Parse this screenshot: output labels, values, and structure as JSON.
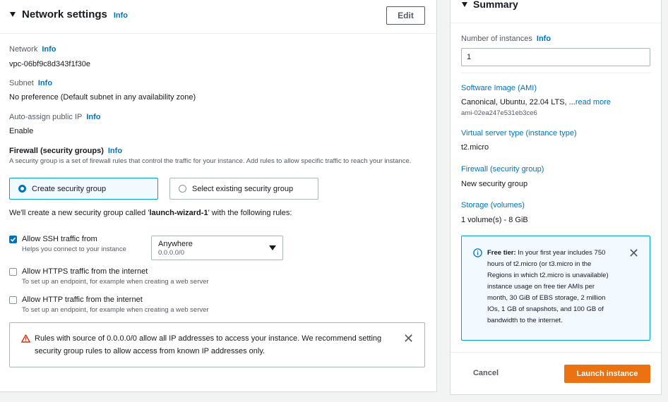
{
  "network_settings": {
    "title": "Network settings",
    "info": "Info",
    "edit_label": "Edit",
    "network_label": "Network",
    "network_value": "vpc-06bf9c8d343f1f30e",
    "subnet_label": "Subnet",
    "subnet_value": "No preference (Default subnet in any availability zone)",
    "public_ip_label": "Auto-assign public IP",
    "public_ip_value": "Enable",
    "firewall_label": "Firewall (security groups)",
    "firewall_desc": "A security group is a set of firewall rules that control the traffic for your instance. Add rules to allow specific traffic to reach your instance.",
    "create_sg_label": "Create security group",
    "select_sg_label": "Select existing security group",
    "sg_note_prefix": "We'll create a new security group called '",
    "sg_name": "launch-wizard-1",
    "sg_note_suffix": "' with the following rules:",
    "rules": [
      {
        "label": "Allow SSH traffic from",
        "desc": "Helps you connect to your instance",
        "checked": true
      },
      {
        "label": "Allow HTTPS traffic from the internet",
        "desc": "To set up an endpoint, for example when creating a web server",
        "checked": false
      },
      {
        "label": "Allow HTTP traffic from the internet",
        "desc": "To set up an endpoint, for example when creating a web server",
        "checked": false
      }
    ],
    "ssh_source": {
      "value": "Anywhere",
      "sub": "0.0.0.0/0"
    },
    "warning_text": "Rules with source of 0.0.0.0/0 allow all IP addresses to access your instance. We recommend setting security group rules to allow access from known IP addresses only."
  },
  "summary": {
    "title": "Summary",
    "instances_label": "Number of instances",
    "info": "Info",
    "instances_value": "1",
    "ami_label": "Software Image (AMI)",
    "ami_value": "Canonical, Ubuntu, 22.04 LTS, ...",
    "ami_read_more": "read more",
    "ami_id": "ami-02ea247e531eb3ce6",
    "instance_type_label": "Virtual server type (instance type)",
    "instance_type_value": "t2.micro",
    "firewall_label": "Firewall (security group)",
    "firewall_value": "New security group",
    "storage_label": "Storage (volumes)",
    "storage_value": "1 volume(s) - 8 GiB",
    "free_tier_title": "Free tier:",
    "free_tier_lines": [
      " In your first year includes 750",
      "hours of t2.micro (or t3.micro in the",
      "Regions in which t2.micro is unavailable)",
      "instance usage on free tier AMIs per",
      "month, 30 GiB of EBS storage, 2 million",
      "IOs, 1 GB of snapshots, and 100 GB of",
      "bandwidth to the internet."
    ],
    "cancel_label": "Cancel",
    "launch_label": "Launch instance"
  },
  "colors": {
    "accent": "#0073bb",
    "launch": "#ec7211",
    "info_border": "#00a1c9",
    "warning_icon": "#d13212"
  }
}
